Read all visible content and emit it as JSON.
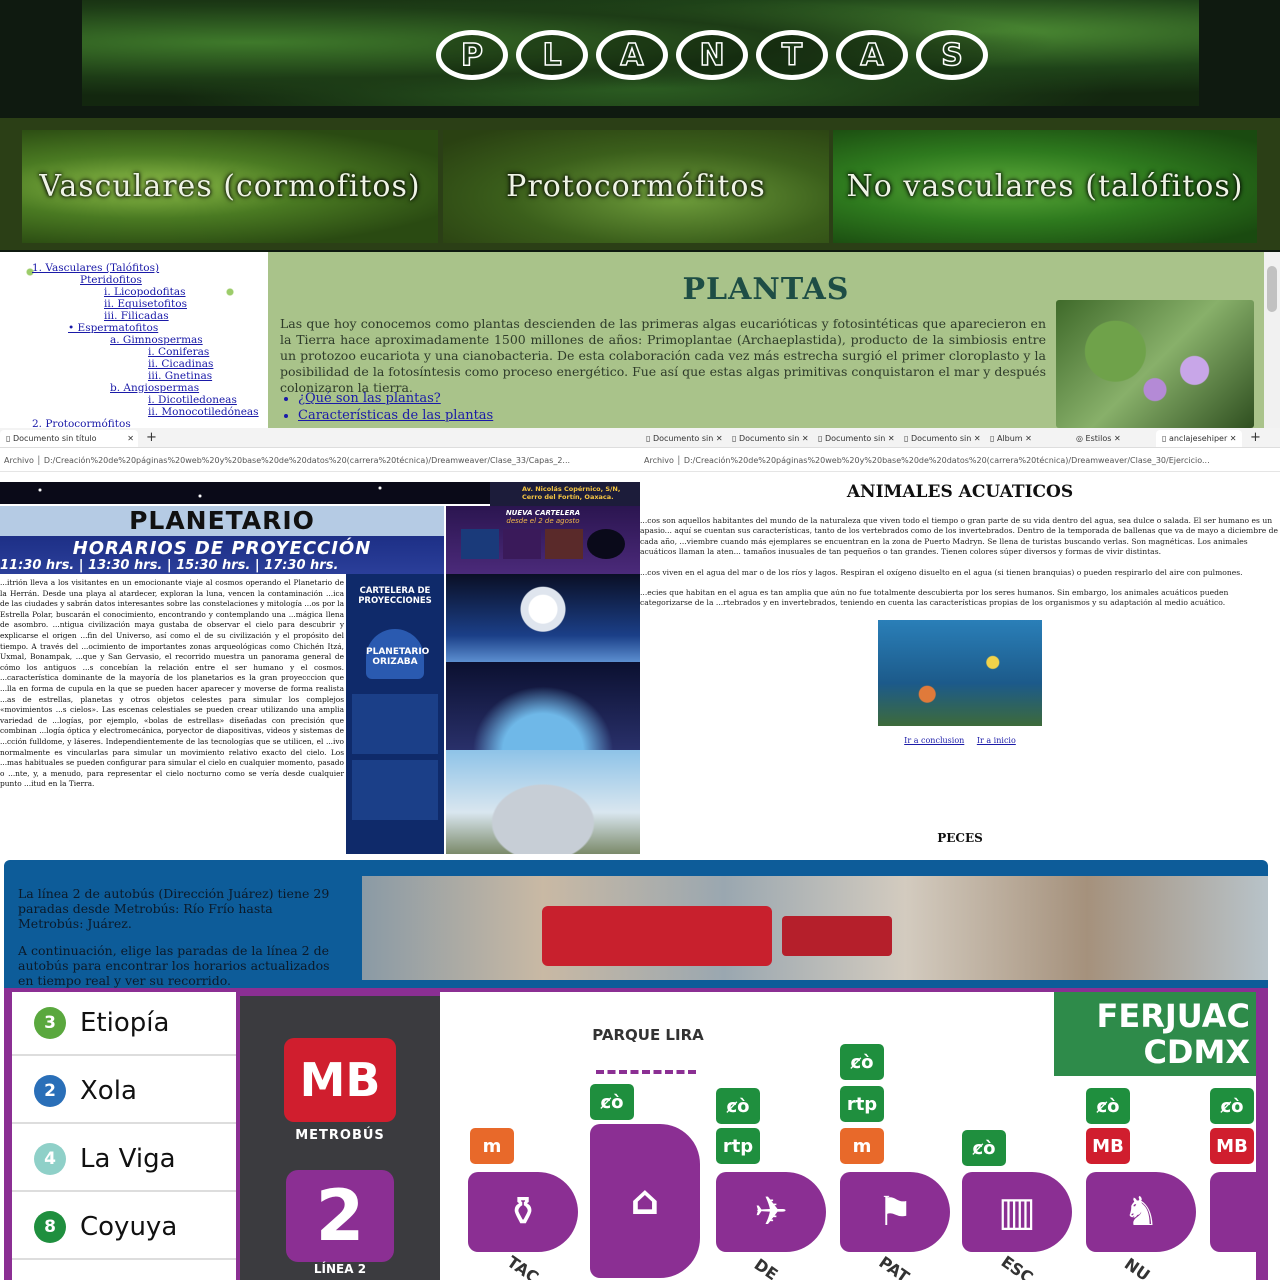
{
  "plantas": {
    "banner_letters": [
      "P",
      "L",
      "A",
      "N",
      "T",
      "A",
      "S"
    ],
    "categories": [
      "Vasculares (cormofitos)",
      "Protocormófitos",
      "No vasculares (talófitos)"
    ],
    "nav": {
      "items": [
        {
          "label": "1. Vasculares (Talófitos)",
          "indent": 32
        },
        {
          "label": "Pteridofitos",
          "indent": 80
        },
        {
          "label": "i. Licopodofitas",
          "indent": 104
        },
        {
          "label": "ii. Equisetofitos",
          "indent": 104
        },
        {
          "label": "iii. Filicadas",
          "indent": 104
        },
        {
          "label": "• Espermatofitos",
          "indent": 68
        },
        {
          "label": "a. Gimnospermas",
          "indent": 110
        },
        {
          "label": "i. Coniferas",
          "indent": 148
        },
        {
          "label": "ii. Cicadinas",
          "indent": 148
        },
        {
          "label": "iii. Gnetinas",
          "indent": 148
        },
        {
          "label": "b. Angiospermas",
          "indent": 110
        },
        {
          "label": "i. Dicotiledoneas",
          "indent": 148
        },
        {
          "label": "ii. Monocotiledóneas",
          "indent": 148
        },
        {
          "label": "2. Protocormófitos",
          "indent": 32
        }
      ]
    },
    "heading": "PLANTAS",
    "paragraph": "Las que hoy conocemos como plantas descienden de las primeras algas eucarióticas y fotosintéticas que aparecieron en la Tierra hace aproximadamente 1500 millones de años: Primoplantae (Archaeplastida), producto de la simbiosis entre un protozoo eucariota y una cianobacteria. De esta colaboración cada vez más estrecha surgió el primer cloroplasto y la posibilidad de la fotosíntesis como proceso energético. Fue así que estas algas primitivas conquistaron el mar y después colonizaron la tierra.",
    "links": [
      "¿Qué son las plantas?",
      "Características de las plantas"
    ]
  },
  "browser_left": {
    "tab_title": "Documento sin título",
    "address": "D:/Creación%20de%20páginas%20web%20y%20base%20de%20datos%20(carrera%20técnica)/Dreamweaver/Clase_33/Capas_2..."
  },
  "browser_right": {
    "tabs": [
      "Documento sin",
      "Documento sin",
      "Documento sin",
      "Documento sin",
      "Album",
      "Estilos",
      "anclajesehiper"
    ],
    "address": "D:/Creación%20de%20páginas%20web%20y%20base%20de%20datos%20(carrera%20técnica)/Dreamweaver/Clase_30/Ejercicio..."
  },
  "planetario": {
    "address_box": "Av. Nicolás Copérnico, S/N, Cerro del Fortín, Oaxaca.",
    "title": "PLANETARIO",
    "horarios_title": "HORARIOS DE PROYECCIÓN",
    "horarios_times": "11:30 hrs. | 13:30 hrs. | 15:30 hrs. | 17:30 hrs.",
    "nueva_cartelera": "NUEVA CARTELERA",
    "nueva_sub": "desde el 2 de agosto",
    "cartelera_title": "CARTELERA DE PROYECCIONES",
    "logo_text": "PLANETARIO ORIZABA",
    "body_text": "...itrión lleva a los visitantes en un emocionante viaje al cosmos operando el Planetario de la Herrán. Desde una playa al atardecer, exploran la luna, vencen la contaminación ...ica de las ciudades y sabrán datos interesantes sobre las constelaciones y mitología ...os por la Estrella Polar, buscarán el conocimiento, encontrando y contemplando una ...mágica llena de asombro. ...ntigua civilización maya gustaba de observar el cielo para descubrir y explicarse el origen ...fin del Universo, así como el de su civilización y el propósito del tiempo. A través del ...ocimiento de importantes zonas arqueológicas como Chichén Itzá, Uxmal, Bonampak, ...que y San Gervasio, el recorrido muestra un panorama general de cómo los antiguos ...s concebían la relación entre el ser humano y el cosmos. ...característica dominante de la mayoría de los planetarios es la gran proyecccion que ...lla en forma de cupula en la que se pueden hacer aparecer y moverse de forma realista ...as de estrellas, planetas y otros objetos celestes para simular los complejos «movimientos ...s cielos». Las escenas celestiales se pueden crear utilizando una amplia variedad de ...logías, por ejemplo, «bolas de estrellas» diseñadas con precisión que combinan ...logía óptica y electromecánica, poryector de diapositivas, videos y sistemas de ...cción fulldome, y láseres. Independientemente de las tecnologías que se utilicen, el ...ivo normalmente es vincularlas para simular un movimiento relativo exacto del cielo. Los ...mas habituales se pueden configurar para simular el cielo en cualquier momento, pasado o ...nte, y, a menudo, para representar el cielo nocturno como se vería desde cualquier punto ...itud en la Tierra."
  },
  "animales": {
    "heading": "ANIMALES ACUATICOS",
    "p1": "...cos son aquellos habitantes del mundo de la naturaleza que viven todo el tiempo o gran parte de su vida dentro del agua, sea dulce o salada. El ser humano es un apasio... aquí se cuentan sus características, tanto de los vertebrados como de los invertebrados. Dentro de la temporada de ballenas que va de mayo a diciembre de cada año, ...viembre cuando más ejemplares se encuentran en la zona de Puerto Madryn. Se llena de turistas buscando verlas. Son magnéticas. Los animales acuáticos llaman la aten... tamaños inusuales de tan pequeños o tan grandes. Tienen colores súper diversos y formas de vivir distintas.",
    "p2": "...cos viven en el agua del mar o de los ríos y lagos. Respiran el oxígeno disuelto en el agua (si tienen branquias) o pueden respirarlo del aire con pulmones.",
    "p3": "...ecies que habitan en el agua es tan amplia que aún no fue totalmente descubierta por los seres humanos. Sin embargo, los animales acuáticos pueden categorizarse de la ...rtebrados y en invertebrados, teniendo en cuenta las características propias de los organismos y su adaptación al medio acuático.",
    "links": [
      "Ir a conclusion",
      "Ir a inicio"
    ],
    "subheading": "PECES"
  },
  "metrobus": {
    "intro_1": "La línea 2 de autobús (Dirección Juárez) tiene 29 paradas desde Metrobús: Río Frío hasta Metrobús: Juárez.",
    "intro_2": "A continuación, elige las paradas de la línea 2 de autobús para encontrar los horarios actualizados en tiempo real y ver su recorrido.",
    "stops": [
      {
        "num": "3",
        "name": "Etiopía",
        "color": "#5aa83e"
      },
      {
        "num": "2",
        "name": "Xola",
        "color": "#2a6fb8"
      },
      {
        "num": "4",
        "name": "La Viga",
        "color": "#8fd0c8"
      },
      {
        "num": "8",
        "name": "Coyuya",
        "color": "#1f8f3e"
      }
    ],
    "mb_logo": "MB",
    "mb_text": "METROBÚS",
    "line_number": "2",
    "line_text": "LÍNEA 2",
    "ferjuac": "FERJUAC CDMX",
    "parque_lira": "PARQUE LIRA",
    "station_labels": [
      "TAC",
      "DE",
      "PAT",
      "ESC",
      "NU"
    ],
    "colors": {
      "metrobus_purple": "#8b2f93",
      "metrobus_red": "#d01e2e",
      "green": "#1f8f3e"
    }
  }
}
